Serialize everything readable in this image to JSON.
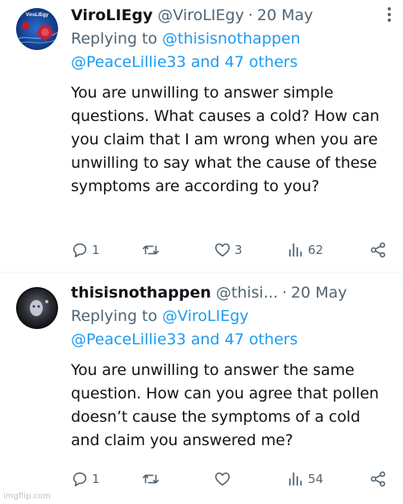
{
  "tweets": [
    {
      "name": "ViroLIEgy",
      "handle": "@ViroLIEgy",
      "separator": "·",
      "date": "20 May",
      "replying_prefix": "Replying to ",
      "replying_user": "@thisisnothappen",
      "replying_line2": "@PeaceLillie33 and 47 others",
      "avatar_logo_text": "ViroLIEgy",
      "text": "You are unwilling to answer simple questions. What causes a cold? How can you claim that I am wrong when you are unwilling to say what the cause of these symptoms are according to you?",
      "replies_count": "1",
      "retweets_count": "",
      "likes_count": "3",
      "views_count": "62"
    },
    {
      "name": "thisisnothappen",
      "handle": "@thisi...",
      "separator": "·",
      "date": "20 May",
      "replying_prefix": "Replying to ",
      "replying_user": "@ViroLIEgy",
      "replying_line2": "@PeaceLillie33 and 47 others",
      "text": "You are unwilling to answer the same question. How can you agree that pollen doesn’t cause the symptoms of a cold and claim you answered me?",
      "replies_count": "1",
      "retweets_count": "",
      "likes_count": "",
      "views_count": "54"
    }
  ],
  "watermark": "imgflip.com",
  "colors": {
    "text": "#0f1419",
    "secondary": "#536471",
    "link": "#1d9bf0"
  }
}
